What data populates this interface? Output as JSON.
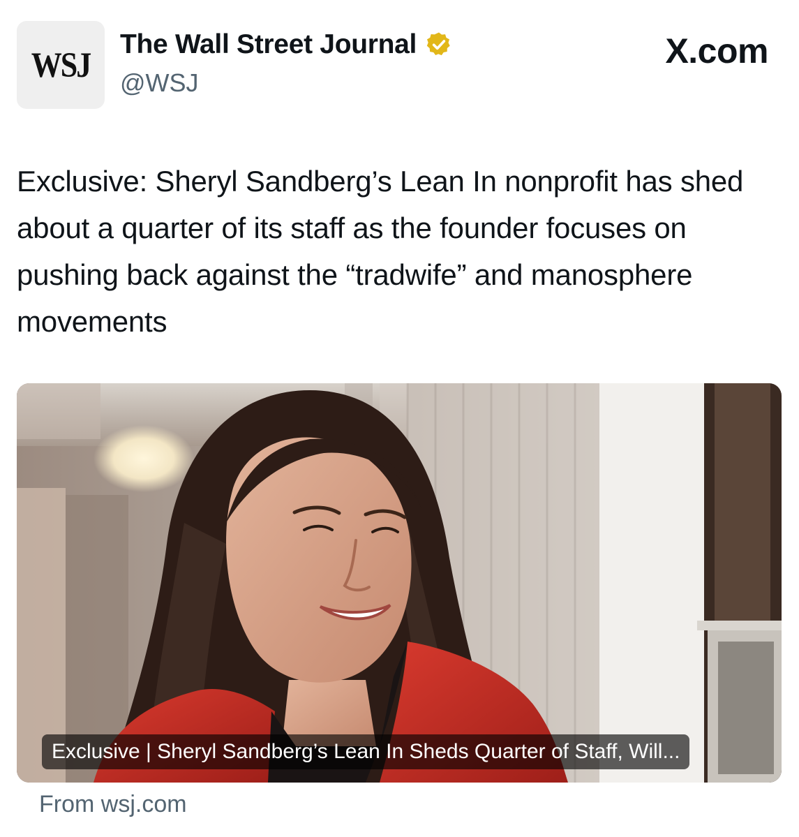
{
  "post": {
    "avatar_text": "WSJ",
    "account_name": "The Wall Street Journal",
    "handle": "@WSJ",
    "site_logo": "X.com",
    "verified_icon": "verified-badge-icon",
    "text": "Exclusive: Sheryl Sandberg’s Lean In nonprofit has shed about a quarter of its staff as the founder focuses on pushing back against the “tradwife” and manosphere movements"
  },
  "card": {
    "image": "photo-of-smiling-woman-red-jacket",
    "caption": "Exclusive | Sheryl Sandberg’s Lean In Sheds Quarter of Staff, Will..."
  },
  "footer": {
    "source": "From wsj.com"
  },
  "colors": {
    "text": "#0f1419",
    "muted": "#536471",
    "verified_gold": "#e2b719",
    "jacket_red": "#c42a22"
  }
}
